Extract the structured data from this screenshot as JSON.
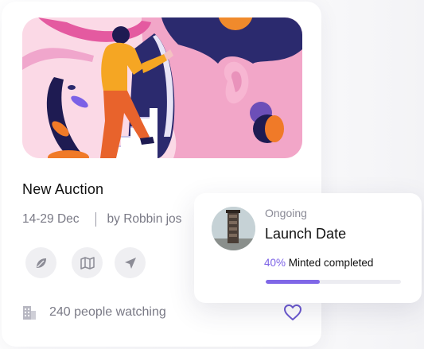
{
  "auction_card": {
    "title": "New Auction",
    "dates": "14-29 Dec",
    "author": "by Robbin jos",
    "watching": "240 people watching",
    "actions": [
      {
        "icon": "leaf-icon"
      },
      {
        "icon": "map-icon"
      },
      {
        "icon": "send-icon"
      }
    ]
  },
  "launch_card": {
    "status": "Ongoing",
    "title": "Launch Date",
    "progress_percent_label": "40%",
    "progress_text": " Minted completed",
    "progress_fraction": 0.4
  },
  "colors": {
    "accent": "#7b61e6",
    "artwork_pink": "#fbd9e6",
    "text_primary": "#111111",
    "text_muted": "#7a7a86"
  }
}
